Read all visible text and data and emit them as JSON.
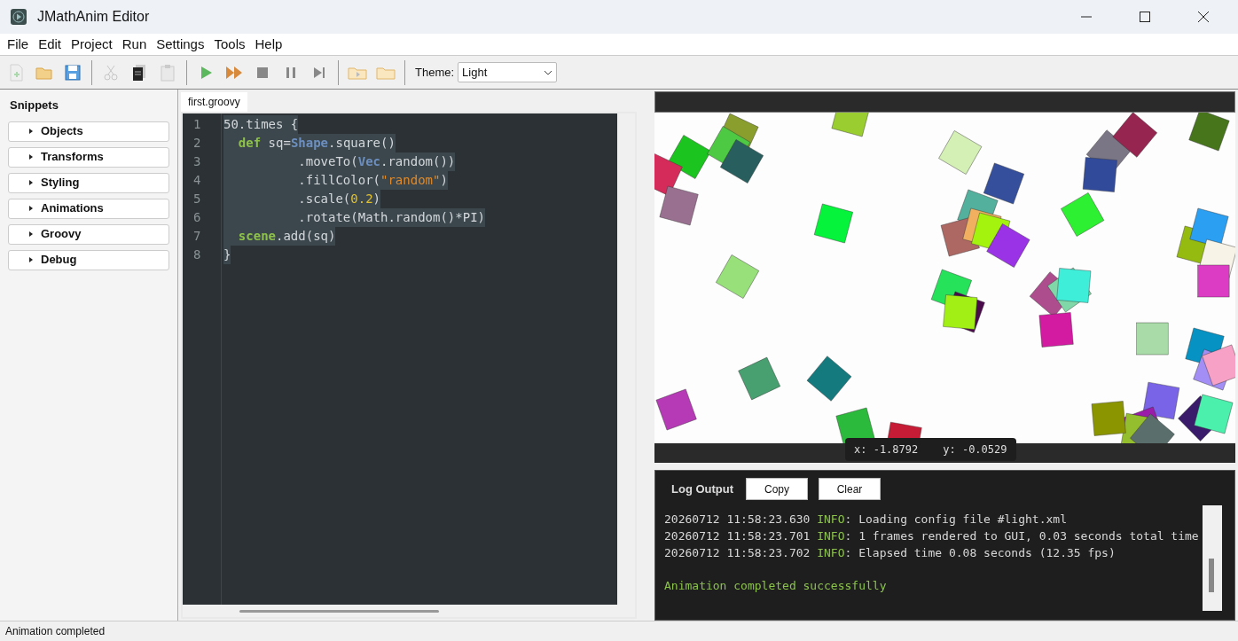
{
  "window": {
    "title": "JMathAnim Editor"
  },
  "menu": [
    "File",
    "Edit",
    "Project",
    "Run",
    "Settings",
    "Tools",
    "Help"
  ],
  "toolbar": [
    {
      "kind": "new",
      "disabled": true
    },
    {
      "kind": "open",
      "disabled": false
    },
    {
      "kind": "save",
      "disabled": false
    },
    {
      "kind": "sep"
    },
    {
      "kind": "cut",
      "disabled": true
    },
    {
      "kind": "copy",
      "disabled": false
    },
    {
      "kind": "paste",
      "disabled": true
    },
    {
      "kind": "sep"
    },
    {
      "kind": "run",
      "disabled": false
    },
    {
      "kind": "fast",
      "disabled": false
    },
    {
      "kind": "stop",
      "disabled": false
    },
    {
      "kind": "pause",
      "disabled": false
    },
    {
      "kind": "step",
      "disabled": false
    },
    {
      "kind": "sep"
    },
    {
      "kind": "folder-play",
      "disabled": false
    },
    {
      "kind": "folder",
      "disabled": false
    },
    {
      "kind": "sep"
    }
  ],
  "theme": {
    "label": "Theme:",
    "value": "Light"
  },
  "snippets": {
    "title": "Snippets",
    "items": [
      {
        "label": "Objects",
        "expanded": false
      },
      {
        "label": "Transforms",
        "expanded": false
      },
      {
        "label": "Styling",
        "expanded": false
      },
      {
        "label": "Animations",
        "expanded": false
      },
      {
        "label": "Groovy",
        "expanded": false
      },
      {
        "label": "Debug",
        "expanded": false
      }
    ]
  },
  "editor": {
    "tabs": [
      {
        "label": "first.groovy",
        "selected": true
      }
    ],
    "lines": [
      {
        "number": "1",
        "tokens": [
          {
            "kind": "plain",
            "text": "50.times {"
          }
        ]
      },
      {
        "number": "2",
        "tokens": [
          {
            "kind": "keyword",
            "text": "  def"
          },
          {
            "kind": "plain",
            "text": " sq="
          },
          {
            "kind": "class",
            "text": "Shape"
          },
          {
            "kind": "plain",
            "text": ".square()"
          }
        ]
      },
      {
        "number": "3",
        "tokens": [
          {
            "kind": "plain",
            "text": "          .moveTo("
          },
          {
            "kind": "class",
            "text": "Vec"
          },
          {
            "kind": "plain",
            "text": ".random())"
          }
        ]
      },
      {
        "number": "4",
        "tokens": [
          {
            "kind": "plain",
            "text": "          .fillColor("
          },
          {
            "kind": "string",
            "text": "\"random\""
          },
          {
            "kind": "plain",
            "text": ")"
          }
        ]
      },
      {
        "number": "5",
        "tokens": [
          {
            "kind": "plain",
            "text": "          .scale("
          },
          {
            "kind": "number",
            "text": "0.2"
          },
          {
            "kind": "plain",
            "text": ")"
          }
        ]
      },
      {
        "number": "6",
        "tokens": [
          {
            "kind": "plain",
            "text": "          .rotate(Math.random()*PI)"
          }
        ]
      },
      {
        "number": "7",
        "tokens": [
          {
            "kind": "keyword",
            "text": "  scene"
          },
          {
            "kind": "plain",
            "text": ".add(sq)"
          }
        ]
      },
      {
        "number": "8",
        "tokens": [
          {
            "kind": "plain",
            "text": "}"
          }
        ]
      }
    ]
  },
  "preview": {
    "coordinates": {
      "x": "x: -1.8792",
      "y": "y: -0.0529"
    }
  },
  "log": {
    "title": "Log Output",
    "buttons": [
      "Copy",
      "Clear"
    ],
    "entries": [
      {
        "kind": "info",
        "time": "20260712 11:58:23.630",
        "level": "INFO",
        "message": ": Loading config file #light.xml"
      },
      {
        "kind": "info",
        "time": "20260712 11:58:23.701",
        "level": "INFO",
        "message": ": 1 frames rendered to GUI, 0.03 seconds total time"
      },
      {
        "kind": "info",
        "time": "20260712 11:58:23.702",
        "level": "INFO",
        "message": ": Elapsed time 0.08 seconds (12.35 fps)"
      },
      {
        "kind": "blank"
      },
      {
        "kind": "success",
        "message": "Animation completed successfully"
      }
    ]
  },
  "status_bar": "Animation completed"
}
